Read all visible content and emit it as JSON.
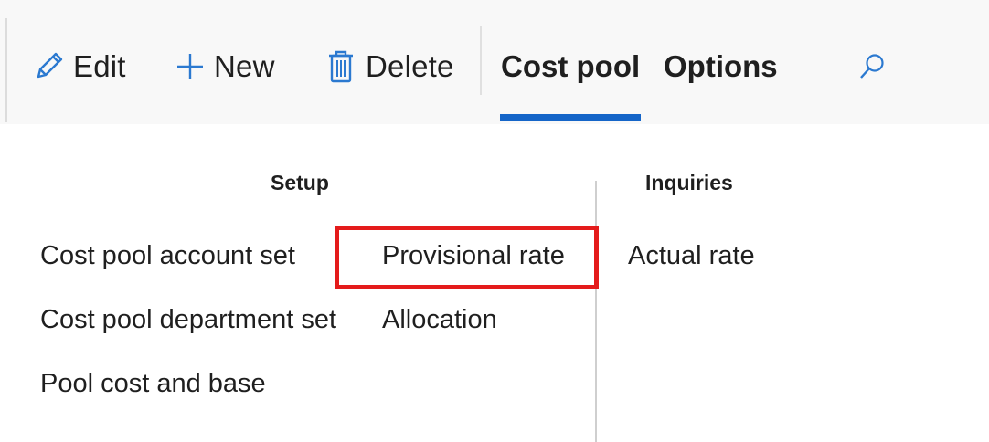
{
  "toolbar": {
    "edit_label": "Edit",
    "new_label": "New",
    "delete_label": "Delete"
  },
  "tabs": [
    {
      "label": "Cost pool",
      "active": true
    },
    {
      "label": "Options",
      "active": false
    }
  ],
  "icons": {
    "edit": "pencil-icon",
    "new": "plus-icon",
    "delete": "trash-icon",
    "search": "search-icon"
  },
  "groups": {
    "setup": {
      "title": "Setup",
      "col1": [
        "Cost pool account set",
        "Cost pool department set",
        "Pool cost and base"
      ],
      "col2": [
        "Provisional rate",
        "Allocation"
      ]
    },
    "inquiries": {
      "title": "Inquiries",
      "items": [
        "Actual rate"
      ]
    }
  },
  "colors": {
    "accent": "#1565c8",
    "icon": "#2b79d0",
    "highlight": "#e41b1b",
    "toolbar_bg": "#f8f8f8"
  }
}
